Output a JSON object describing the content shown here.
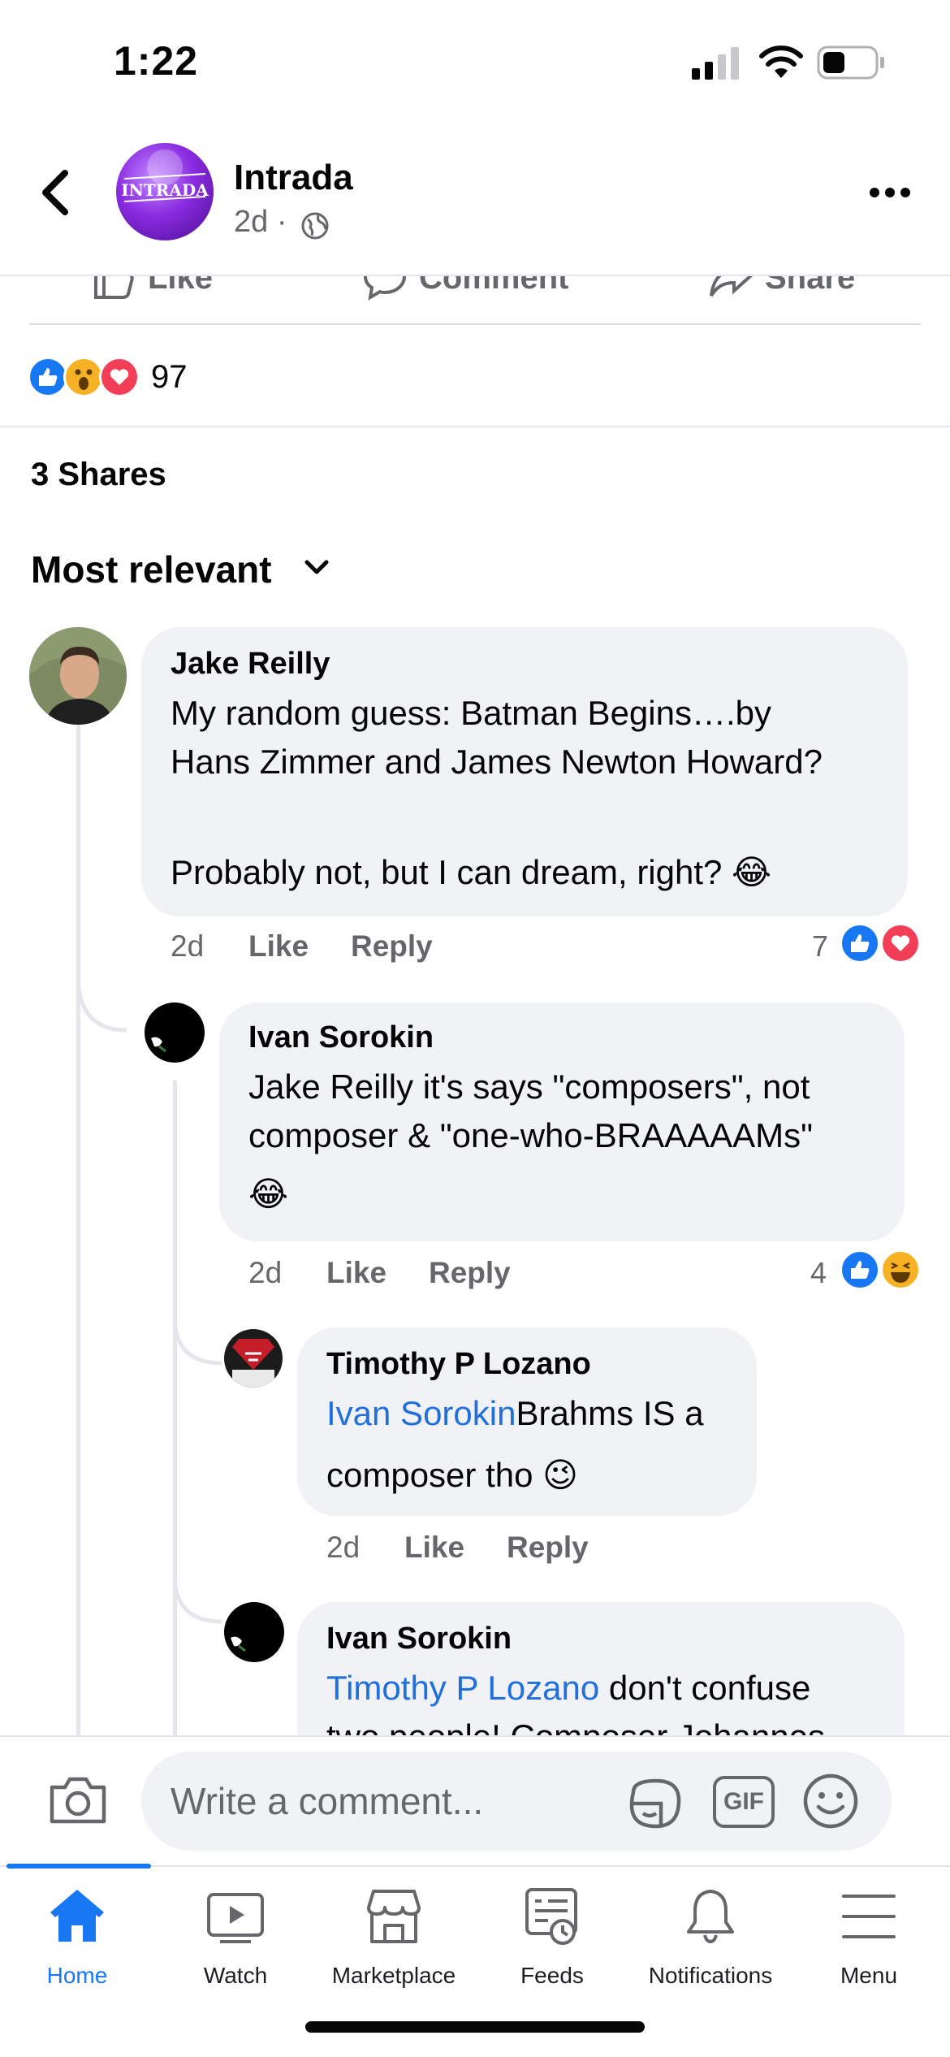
{
  "status_bar": {
    "time": "1:22"
  },
  "header": {
    "page_name": "Intrada",
    "age": "2d",
    "dot": "·",
    "logo_text": "INTRADA"
  },
  "post_actions": {
    "like": "Like",
    "comment": "Comment",
    "share": "Share"
  },
  "reactions": {
    "count": "97",
    "types": [
      "like",
      "wow",
      "love"
    ]
  },
  "shares": "3 Shares",
  "sort": "Most relevant",
  "comments": [
    {
      "author": "Jake Reilly",
      "text_line1": "My random guess: Batman Begins….by",
      "text_line2": "Hans Zimmer and James Newton Howard?",
      "text_line3": "Probably not, but I can dream, right? 😂",
      "age": "2d",
      "like": "Like",
      "reply": "Reply",
      "reaction_count": "7",
      "reaction_types": [
        "like",
        "love"
      ]
    },
    {
      "author": "Ivan Sorokin",
      "text_line1": "Jake Reilly it's says \"composers\", not",
      "text_line2": "composer & \"one-who-BRAAAAAMs\"",
      "text_line3": "😂",
      "age": "2d",
      "like": "Like",
      "reply": "Reply",
      "reaction_count": "4",
      "reaction_types": [
        "like",
        "haha"
      ]
    },
    {
      "author": "Timothy P Lozano",
      "mention": "Ivan Sorokin",
      "text_rest": "Brahms IS a",
      "text_line2": "composer tho 😉",
      "age": "2d",
      "like": "Like",
      "reply": "Reply"
    },
    {
      "author": "Ivan Sorokin",
      "mention": "Timothy P Lozano",
      "text_rest": " don't confuse",
      "text_line2": "two people! Composer Johannes"
    }
  ],
  "composer": {
    "placeholder": "Write a comment...",
    "gif": "GIF"
  },
  "tabs": [
    {
      "label": "Home",
      "icon": "home-icon",
      "active": true
    },
    {
      "label": "Watch",
      "icon": "watch-icon"
    },
    {
      "label": "Marketplace",
      "icon": "marketplace-icon"
    },
    {
      "label": "Feeds",
      "icon": "feeds-icon"
    },
    {
      "label": "Notifications",
      "icon": "bell-icon"
    },
    {
      "label": "Menu",
      "icon": "menu-icon"
    }
  ],
  "colors": {
    "accent": "#1877f2",
    "link": "#216fdb",
    "bubble": "#f0f2f5",
    "muted": "#65676b",
    "love": "#f33e58",
    "wow": "#f7b125"
  }
}
